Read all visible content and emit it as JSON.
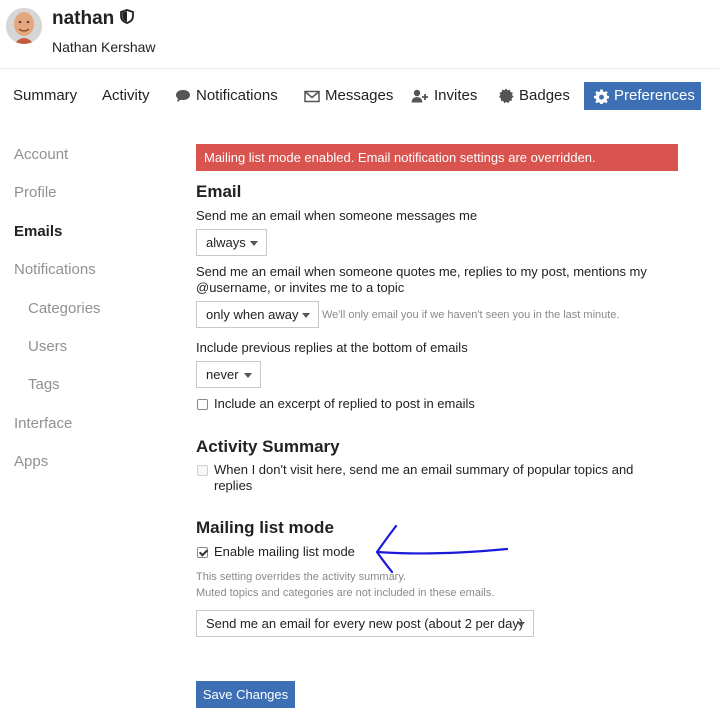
{
  "user": {
    "username": "nathan",
    "full_name": "Nathan Kershaw"
  },
  "nav": {
    "tabs": [
      {
        "label": "Summary",
        "icon": ""
      },
      {
        "label": "Activity",
        "icon": ""
      },
      {
        "label": "Notifications",
        "icon": "comment-icon"
      },
      {
        "label": "Messages",
        "icon": "envelope-icon"
      },
      {
        "label": "Invites",
        "icon": "user-plus-icon"
      },
      {
        "label": "Badges",
        "icon": "certificate-icon"
      },
      {
        "label": "Preferences",
        "icon": "gear-icon"
      }
    ],
    "active": "Preferences"
  },
  "sidebar": {
    "items": [
      "Account",
      "Profile",
      "Emails",
      "Notifications",
      "Categories",
      "Users",
      "Tags",
      "Interface",
      "Apps"
    ],
    "active": "Emails"
  },
  "alert": "Mailing list mode enabled. Email notification settings are overridden.",
  "email": {
    "heading": "Email",
    "messages_label": "Send me an email when someone messages me",
    "messages_value": "always",
    "quotes_label_line1": "Send me an email when someone quotes me, replies to my post, mentions my",
    "quotes_label_line2": "@username, or invites me to a topic",
    "quotes_value": "only when away",
    "quotes_hint": "We'll only email you if we haven't seen you in the last minute.",
    "previous_label": "Include previous replies at the bottom of emails",
    "previous_value": "never",
    "excerpt_label": "Include an excerpt of replied to post in emails",
    "excerpt_checked": false
  },
  "activity_summary": {
    "heading": "Activity Summary",
    "label_line1": "When I don't visit here, send me an email summary of popular topics and",
    "label_line2": "replies",
    "checked": false,
    "disabled": true
  },
  "mailing_list": {
    "heading": "Mailing list mode",
    "enable_label": "Enable mailing list mode",
    "enabled": true,
    "note_line1": "This setting overrides the activity summary.",
    "note_line2": "Muted topics and categories are not included in these emails.",
    "frequency_value": "Send me an email for every new post (about 2 per day)"
  },
  "save_button": "Save Changes",
  "colors": {
    "primary": "#3d6fb5",
    "danger": "#d9534f",
    "annotation": "#1a1adb"
  }
}
